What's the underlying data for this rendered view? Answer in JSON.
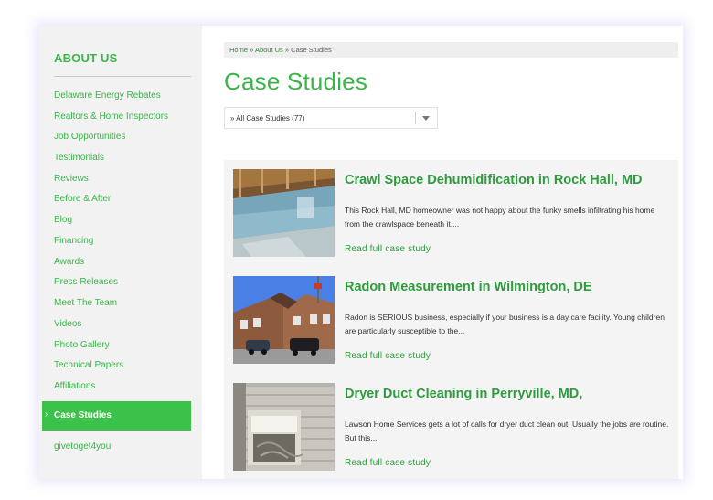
{
  "sidebar": {
    "title": "ABOUT US",
    "items": [
      {
        "label": "Delaware Energy Rebates"
      },
      {
        "label": "Realtors & Home Inspectors"
      },
      {
        "label": "Job Opportunities"
      },
      {
        "label": "Testimonials"
      },
      {
        "label": "Reviews"
      },
      {
        "label": "Before & After"
      },
      {
        "label": "Blog"
      },
      {
        "label": "Financing"
      },
      {
        "label": "Awards"
      },
      {
        "label": "Press Releases"
      },
      {
        "label": "Meet The Team"
      },
      {
        "label": "Videos"
      },
      {
        "label": "Photo Gallery"
      },
      {
        "label": "Technical Papers"
      },
      {
        "label": "Affiliations"
      }
    ],
    "active_item": "Case Studies",
    "active_chevron": "›",
    "last_item": "givetoget4you"
  },
  "breadcrumb": {
    "home": "Home",
    "sep1": " » ",
    "about": "About Us",
    "sep2": " » ",
    "current": "Case Studies"
  },
  "page": {
    "title": "Case Studies"
  },
  "filter": {
    "selected": "» All Case Studies (77)"
  },
  "cards": [
    {
      "title": "Crawl Space Dehumidification in Rock Hall, MD",
      "excerpt": "This Rock Hall, MD homeowner was not happy about the funky smells infiltrating his home from the crawlspace beneath it....",
      "link": "Read full case study"
    },
    {
      "title": "Radon Measurement in Wilmington, DE",
      "excerpt": "Radon is SERIOUS business, especially if your business is a day care facility. Young children are particularly susceptible to the...",
      "link": "Read full case study"
    },
    {
      "title": "Dryer Duct Cleaning in Perryville, MD,",
      "excerpt": "Lawson Home Services gets a lot of calls for dryer duct clean out. Usually the jobs are routine. But this...",
      "link": "Read full case study"
    }
  ],
  "colors": {
    "brand_green": "#3bb54a",
    "active_bg": "#3bc24a",
    "link_green": "#2e9c3e"
  }
}
